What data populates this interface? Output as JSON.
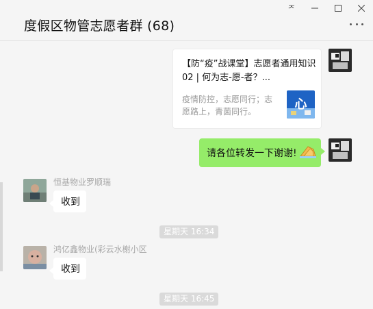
{
  "window": {
    "controls": [
      "pin-icon",
      "minimize-icon",
      "maximize-icon",
      "close-icon"
    ],
    "pin_glyph": "ᅎ"
  },
  "header": {
    "title": "度假区物管志愿者群 (68)",
    "more_icon": "more-dots-icon"
  },
  "messages": {
    "link_card": {
      "title": "【防“疫”战课堂】志愿者通用知识02 | 何为志-愿-者？...",
      "description": "疫情防控，志愿同行；志愿路上，青菌同行。",
      "thumb_text": "心"
    },
    "outgoing_text": {
      "text": "请各位转发一下谢谢!",
      "emoji": "folded-hands-icon"
    },
    "incoming_1": {
      "sender": "恒基物业罗顺瑞",
      "text": "收到"
    },
    "time_1": "星期天 16:34",
    "incoming_2": {
      "sender": "鸿亿鑫物业(彩云水榭小区",
      "text": "收到"
    },
    "time_2": "星期天 16:45"
  },
  "colors": {
    "outgoing_bubble": "#95ec69",
    "incoming_bubble": "#ffffff",
    "background": "#f5f5f5"
  }
}
